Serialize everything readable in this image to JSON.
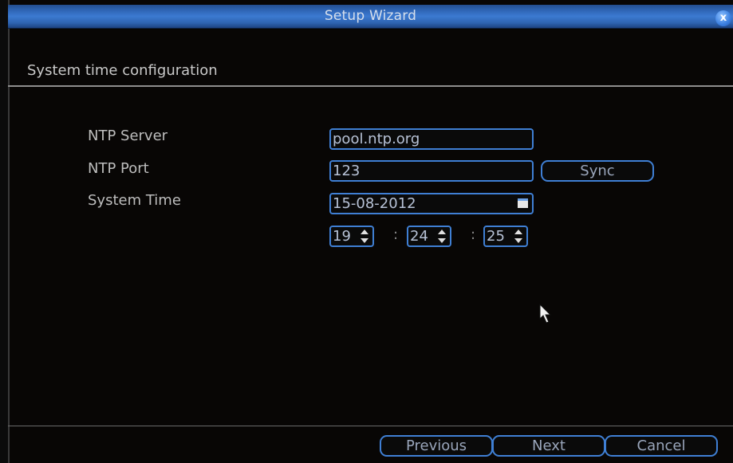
{
  "window": {
    "title": "Setup Wizard",
    "close_label": "x"
  },
  "section": {
    "title": "System time configuration"
  },
  "form": {
    "ntp_server": {
      "label": "NTP Server",
      "value": "pool.ntp.org"
    },
    "ntp_port": {
      "label": "NTP Port",
      "value": "123"
    },
    "sync_label": "Sync",
    "system_time": {
      "label": "System Time",
      "date": "15-08-2012",
      "hour": "19",
      "minute": "24",
      "second": "25",
      "separator": ":"
    }
  },
  "footer": {
    "previous_label": "Previous",
    "next_label": "Next",
    "cancel_label": "Cancel"
  },
  "icons": {
    "calendar": "calendar-icon",
    "spin_up": "arrow-up-icon",
    "spin_down": "arrow-down-icon",
    "close": "close-icon",
    "cursor": "mouse-pointer-icon"
  },
  "colors": {
    "accent": "#3f7fd4",
    "titlebar": "#3c7ad1",
    "background": "#080605"
  }
}
